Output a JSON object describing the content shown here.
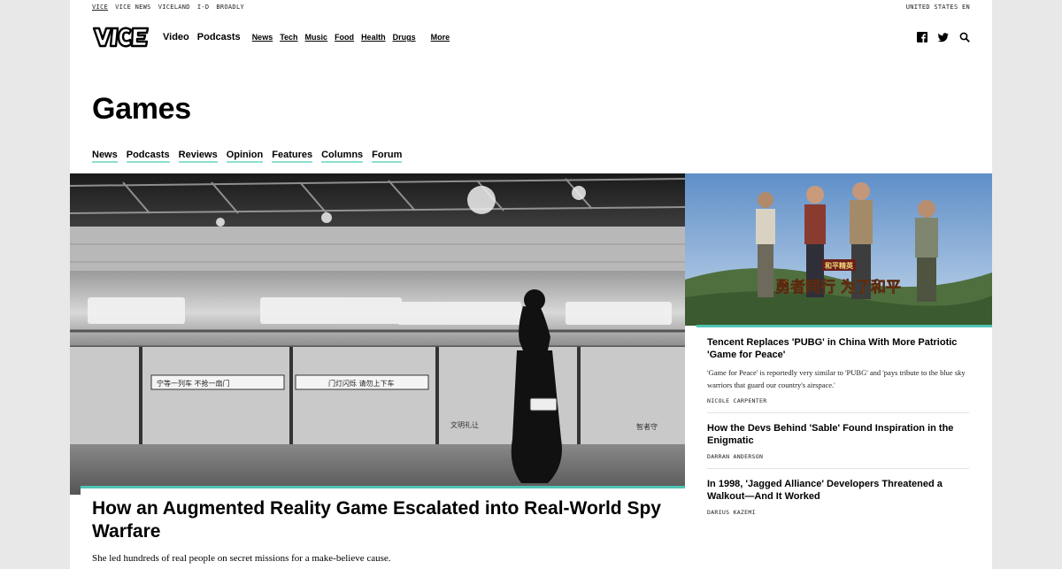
{
  "network": {
    "links": [
      "VICE",
      "VICE NEWS",
      "VICELAND",
      "I-D",
      "BROADLY"
    ],
    "region": "UNITED STATES EN"
  },
  "header": {
    "logo_text": "VICE",
    "primary_nav": [
      "Video",
      "Podcasts"
    ],
    "secondary_nav": [
      "News",
      "Tech",
      "Music",
      "Food",
      "Health",
      "Drugs"
    ],
    "more_label": "More",
    "icons": [
      "facebook-icon",
      "twitter-icon",
      "search-icon"
    ]
  },
  "section": {
    "title": "Games",
    "tabs": [
      "News",
      "Podcasts",
      "Reviews",
      "Opinion",
      "Features",
      "Columns",
      "Forum"
    ]
  },
  "hero": {
    "title": "How an Augmented Reality Game Escalated into Real-World Spy Warfare",
    "dek": "She led hundreds of real people on secret missions for a make-believe cause.",
    "image_signs": [
      "宁等一列车 不抢一扇门",
      "门灯闪烁 请勿上下车",
      "文明礼让",
      "智者守"
    ]
  },
  "side": {
    "image_banner": "勇者同行 为了和平",
    "image_logo": "和平精英",
    "stories": [
      {
        "title": "Tencent Replaces 'PUBG' in China With More Patriotic 'Game for Peace'",
        "dek": "'Game for Peace' is reportedly very similar to 'PUBG' and 'pays tribute to the blue sky warriors that guard our country's airspace.'",
        "author": "NICOLE CARPENTER"
      },
      {
        "title": "How the Devs Behind 'Sable' Found Inspiration in the Enigmatic",
        "dek": "",
        "author": "DARRAN ANDERSON"
      },
      {
        "title": "In 1998, 'Jagged Alliance' Developers Threatened a Walkout—And It Worked",
        "dek": "",
        "author": "DARIUS KAZEMI"
      }
    ]
  },
  "colors": {
    "accent": "#4fc4b4",
    "tab_underline": "#8de0d0",
    "background": "#e8e8e8"
  }
}
